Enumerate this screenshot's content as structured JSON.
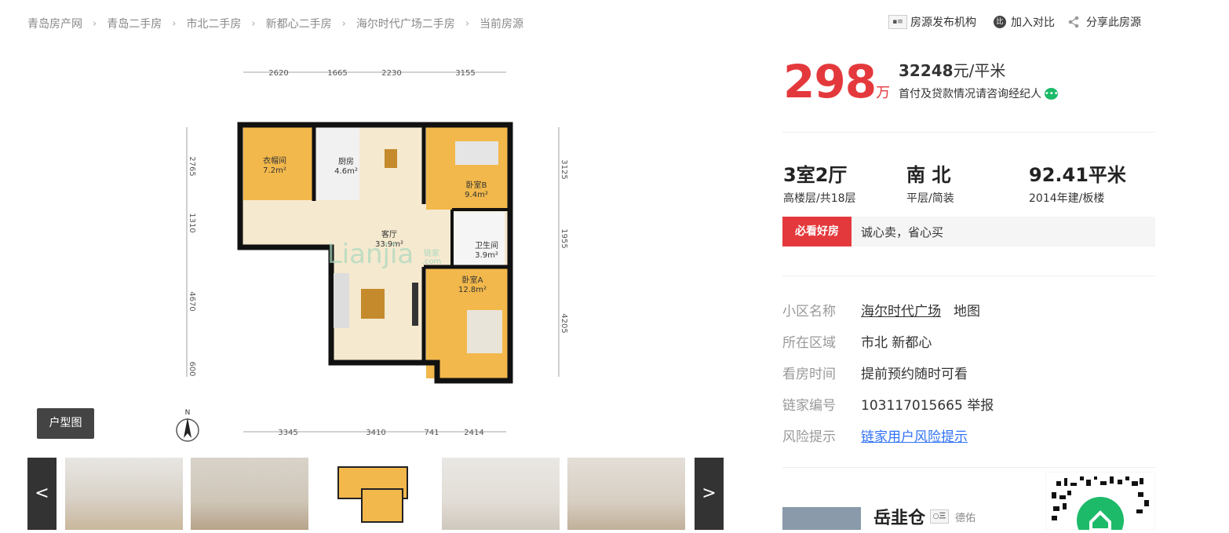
{
  "breadcrumb": [
    "青岛房产网",
    "青岛二手房",
    "市北二手房",
    "新都心二手房",
    "海尔时代广场二手房",
    "当前房源"
  ],
  "actions": {
    "publisher": "房源发布机构",
    "compare": "加入对比",
    "compare_icon_text": "比",
    "share": "分享此房源"
  },
  "floorplan": {
    "tag": "户型图",
    "top_dims": [
      "2620",
      "1665",
      "2230",
      "3155"
    ],
    "bottom_dims": [
      "3345",
      "3410",
      "741",
      "2414"
    ],
    "left_dims": [
      "2765",
      "1310",
      "4670",
      "600"
    ],
    "right_dims": [
      "3125",
      "1955",
      "4205"
    ],
    "rooms": [
      {
        "name": "衣帽间",
        "area": "7.2m²"
      },
      {
        "name": "厨房",
        "area": "4.6m²"
      },
      {
        "name": "卧室B",
        "area": "9.4m²"
      },
      {
        "name": "客厅",
        "area": "33.9m²"
      },
      {
        "name": "卫生间",
        "area": "3.9m²"
      },
      {
        "name": "卧室A",
        "area": "12.8m²"
      }
    ],
    "watermark": "Lianjia",
    "watermark_cn": "链家",
    "watermark_suffix": ".com",
    "compass": "N"
  },
  "gallery": {
    "prev": "<",
    "next": ">",
    "thumbs": [
      "living-room",
      "bedroom",
      "floorplan",
      "bedroom-2",
      "kitchen"
    ]
  },
  "price": {
    "total": "298",
    "unit": "万",
    "per_sqm": "32248",
    "per_sqm_unit": "元/平米",
    "consult": "首付及贷款情况请咨询经纪人",
    "consult_icon": "•••"
  },
  "summary": [
    {
      "main": "3室2厅",
      "sub": "高楼层/共18层"
    },
    {
      "main": "南 北",
      "sub": "平层/简装"
    },
    {
      "main": "92.41平米",
      "sub": "2014年建/板楼"
    }
  ],
  "highlight": {
    "label": "必看好房",
    "text": "诚心卖，省心买"
  },
  "details": [
    {
      "k": "小区名称",
      "v": "海尔时代广场",
      "extra": "地图"
    },
    {
      "k": "所在区域",
      "v": "市北 新都心"
    },
    {
      "k": "看房时间",
      "v": "提前预约随时可看"
    },
    {
      "k": "链家编号",
      "v": "103117015665",
      "extra": "举报"
    },
    {
      "k": "风险提示",
      "v": "链家用户风险提示"
    }
  ],
  "agent": {
    "name": "岳韭仓",
    "company": "德佑",
    "badge": "○三"
  },
  "colors": {
    "accent": "#e4393c",
    "link": "#3072f6",
    "green": "#1dba6a"
  }
}
